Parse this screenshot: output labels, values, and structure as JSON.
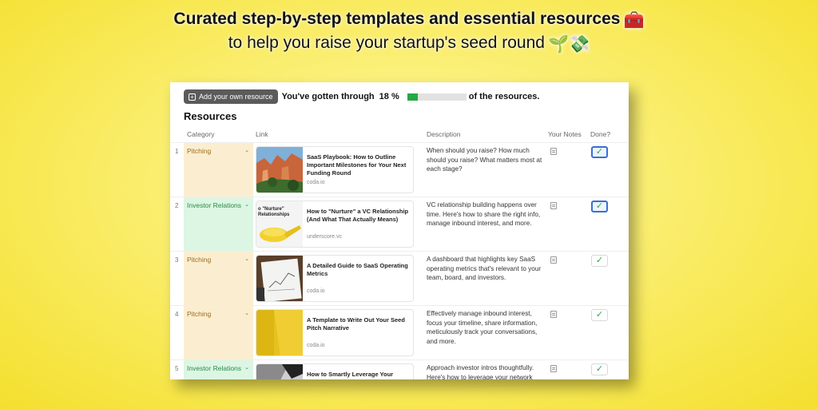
{
  "headline": "Curated step-by-step templates and essential resources",
  "subline": "to help you raise your startup's seed round",
  "emojis": {
    "toolbox": "🧰",
    "seedling": "🌱",
    "money": "💸"
  },
  "toolbar": {
    "add_label": "Add your own resource",
    "progress_prefix": "You've gotten through",
    "progress_value": "18",
    "progress_percent_sign": "%",
    "progress_suffix": "of the resources.",
    "progress_fraction": 0.18
  },
  "section_title": "Resources",
  "columns": {
    "category": "Category",
    "link": "Link",
    "description": "Description",
    "notes": "Your Notes",
    "done": "Done?"
  },
  "rows": [
    {
      "num": "1",
      "category": "Pitching",
      "link_title": "SaaS Playbook: How to Outline Important Milestones for Your Next Funding Round",
      "link_host": "coda.io",
      "description": "When should you raise? How much should you raise? What matters most at each stage?",
      "done": "✓"
    },
    {
      "num": "2",
      "category": "Investor Relations",
      "link_title": "How to \"Nurture\" a VC Relationship (And What That Actually Means)",
      "link_host": "underscore.vc",
      "thumb_text": "o \"Nurture\"\nRelationships",
      "description": "VC relationship building happens over time. Here's how to share the right info, manage inbound interest, and more.",
      "done": "✓"
    },
    {
      "num": "3",
      "category": "Pitching",
      "link_title": "A Detailed Guide to SaaS Operating Metrics",
      "link_host": "coda.io",
      "description": "A dashboard that highlights key SaaS operating metrics that's relevant to your team, board, and investors.",
      "done": "✓"
    },
    {
      "num": "4",
      "category": "Pitching",
      "link_title": "A Template to Write Out Your Seed Pitch Narrative",
      "link_host": "coda.io",
      "description": "Effectively manage inbound interest, focus your timeline, share information, meticulously track your conversations, and more.",
      "done": "✓"
    },
    {
      "num": "5",
      "category": "Investor Relations",
      "link_title": "How to Smartly Leverage Your",
      "link_host": "",
      "description": "Approach investor intros thoughtfully. Here's how to leverage your network",
      "done": "✓"
    }
  ]
}
